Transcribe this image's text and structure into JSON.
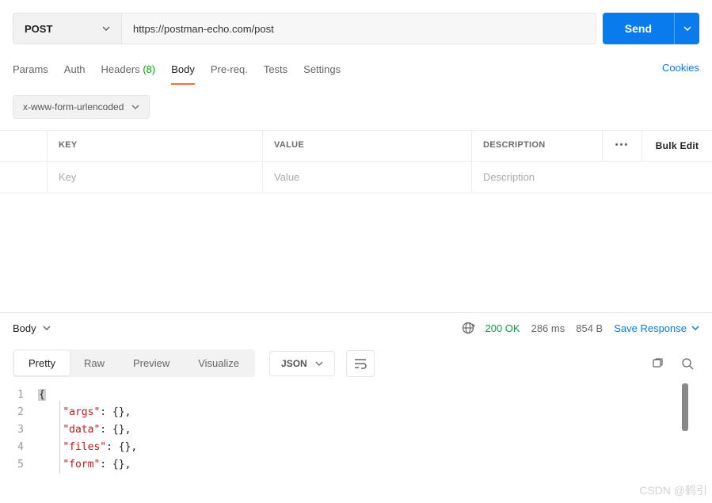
{
  "request": {
    "method": "POST",
    "url": "https://postman-echo.com/post",
    "send_label": "Send"
  },
  "tabs": {
    "items": [
      "Params",
      "Auth",
      "Headers",
      "Body",
      "Pre-req.",
      "Tests",
      "Settings"
    ],
    "headers_badge": "(8)",
    "active": "Body",
    "cookies_label": "Cookies"
  },
  "body_type": {
    "selected": "x-www-form-urlencoded"
  },
  "kv": {
    "headers": {
      "key": "KEY",
      "value": "VALUE",
      "desc": "DESCRIPTION",
      "more": "•••",
      "bulk": "Bulk Edit"
    },
    "placeholders": {
      "key": "Key",
      "value": "Value",
      "desc": "Description"
    }
  },
  "response": {
    "section_label": "Body",
    "status": "200 OK",
    "time": "286 ms",
    "size": "854 B",
    "save_label": "Save Response"
  },
  "view": {
    "tabs": [
      "Pretty",
      "Raw",
      "Preview",
      "Visualize"
    ],
    "active": "Pretty",
    "format": "JSON"
  },
  "code": {
    "lines": [
      {
        "num": 1,
        "indent": 0,
        "raw_open": "{"
      },
      {
        "num": 2,
        "indent": 1,
        "key": "args",
        "after": ": {},"
      },
      {
        "num": 3,
        "indent": 1,
        "key": "data",
        "after": ": {},"
      },
      {
        "num": 4,
        "indent": 1,
        "key": "files",
        "after": ": {},"
      },
      {
        "num": 5,
        "indent": 1,
        "key": "form",
        "after": ": {},"
      }
    ]
  },
  "watermark": "CSDN @鹤引"
}
